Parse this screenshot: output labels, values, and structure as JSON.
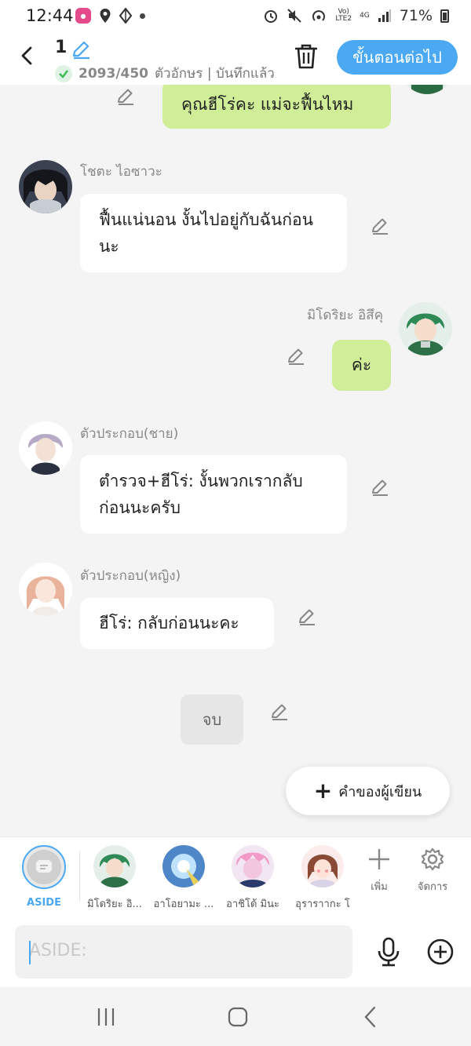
{
  "status_bar": {
    "time": "12:44",
    "battery": "71%",
    "network_top": "Vo)",
    "network_bottom": "LTE2",
    "gen": "4G"
  },
  "header": {
    "episode_number": "1",
    "char_count": "2093/450",
    "save_status": "ตัวอักษร | บันทึกแล้ว",
    "next_label": "ขั้นตอนต่อไป"
  },
  "messages": [
    {
      "side": "right",
      "speaker": "",
      "text": "คุณฮีโร่คะ แม่จะฟื้นไหม"
    },
    {
      "side": "left",
      "speaker": "โชตะ ไอซาวะ",
      "text": "ฟื้นแน่นอน งั้นไปอยู่กับฉันก่อนนะ"
    },
    {
      "side": "right",
      "speaker": "มิโดริยะ อิสึคุ",
      "text": "ค่ะ"
    },
    {
      "side": "left",
      "speaker": "ตัวประกอบ(ชาย)",
      "text": "ตำรวจ+ฮีโร่: งั้นพวกเรากลับก่อนนะครับ"
    },
    {
      "side": "left",
      "speaker": "ตัวประกอบ(หญิง)",
      "text": "ฮีโร่: กลับก่อนนะคะ"
    }
  ],
  "end_label": "จบ",
  "author_button": {
    "plus": "+",
    "label": "คำของผู้เขียน"
  },
  "character_bar": {
    "aside": "ASIDE",
    "characters": [
      "มิโดริยะ อิ...",
      "อาโอยามะ ...",
      "อาชิโด้ มินะ",
      "อุราราากะ โ"
    ],
    "add": "เพิ่ม",
    "manage": "จัดการ"
  },
  "input": {
    "placeholder": "ASIDE:"
  },
  "colors": {
    "accent": "#4aa9f2",
    "bubble_right": "#cfee97",
    "bubble_left": "#ffffff",
    "background": "#f4f4f4"
  }
}
